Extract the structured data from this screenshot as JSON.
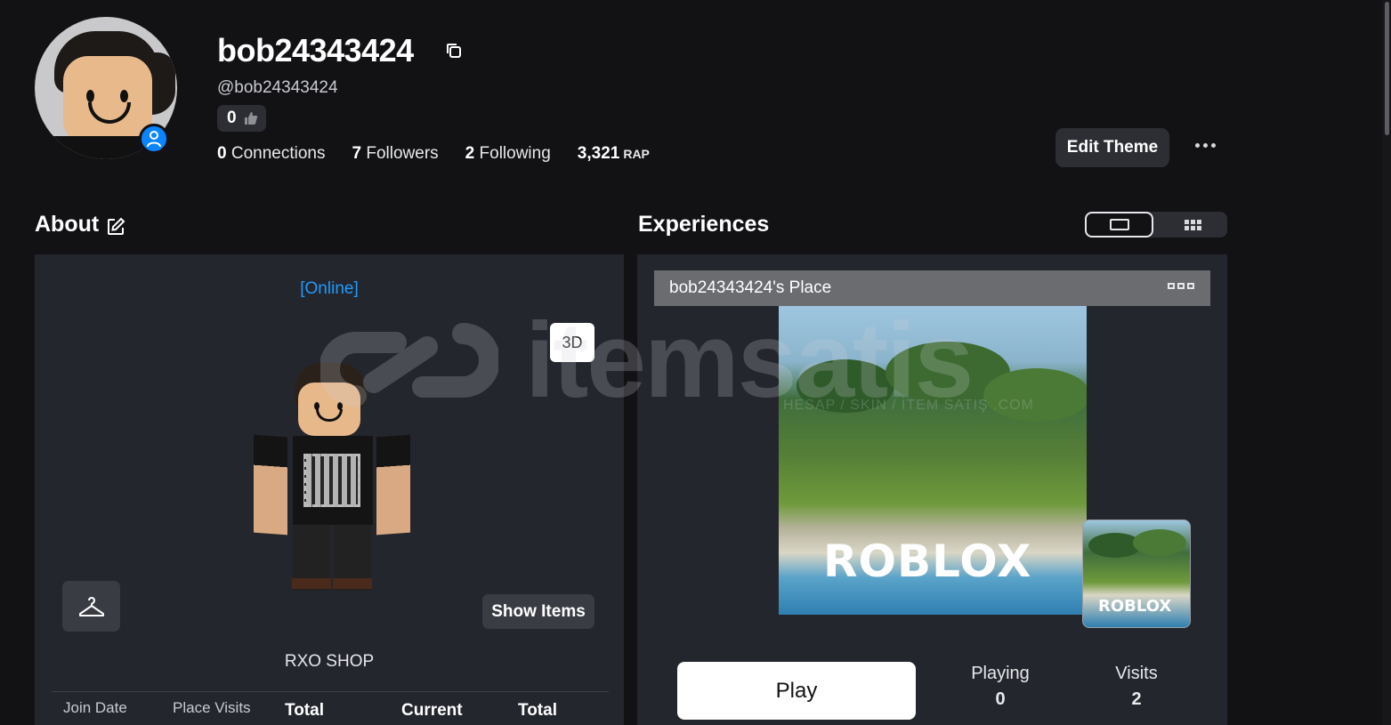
{
  "profile": {
    "display_name": "bob24343424",
    "handle": "@bob24343424",
    "likes": "0",
    "stats": [
      {
        "value": "0",
        "label": "Connections"
      },
      {
        "value": "7",
        "label": "Followers"
      },
      {
        "value": "2",
        "label": "Following"
      }
    ],
    "rap_value": "3,321",
    "rap_label": "RAP",
    "edit_theme_label": "Edit Theme"
  },
  "about": {
    "title": "About",
    "status": "[Online]",
    "view_3d_label": "3D",
    "show_items_label": "Show Items",
    "shop_name": "RXO SHOP",
    "stat_headers": [
      "Join Date",
      "Place Visits",
      "Total",
      "Current",
      "Total"
    ]
  },
  "experiences": {
    "title": "Experiences",
    "place_name": "bob24343424's Place",
    "thumbnail_logo": "ROBLOX",
    "play_label": "Play",
    "playing_label": "Playing",
    "playing_value": "0",
    "visits_label": "Visits",
    "visits_value": "2"
  },
  "watermark": {
    "text": "itemsatis",
    "subtext": "HESAP / SKIN / İTEM SATIŞ .COM"
  },
  "icons": {
    "copy": "copy-icon",
    "presence": "person-icon",
    "like": "thumbs-up-icon",
    "more": "ellipsis-icon",
    "edit": "edit-icon",
    "hanger": "hanger-icon",
    "view_single": "single-view-icon",
    "view_grid": "grid-view-icon"
  },
  "colors": {
    "background": "#121215",
    "panel": "#24262d",
    "online": "#1e9bff",
    "presence_badge": "#0a84ff",
    "button": "#2c2e33"
  }
}
